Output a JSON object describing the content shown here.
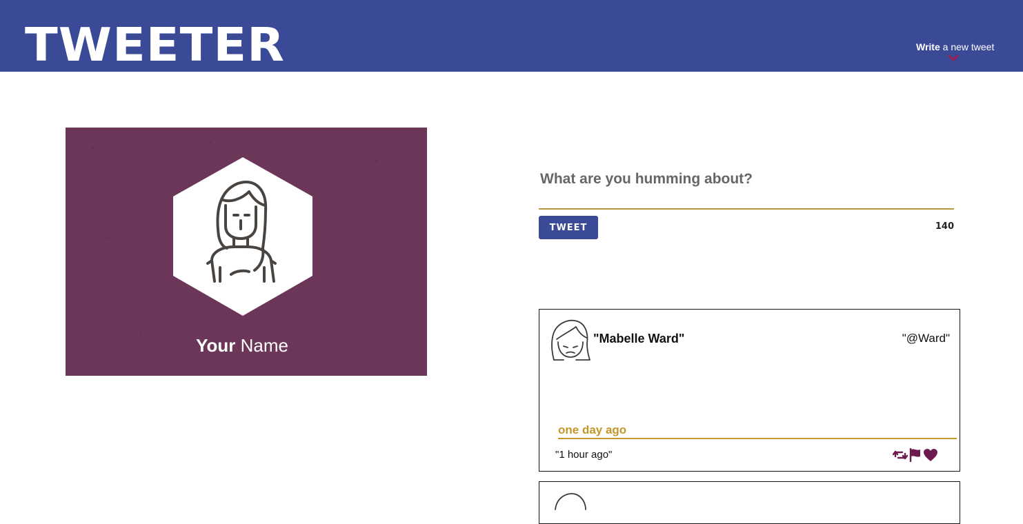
{
  "header": {
    "logo": "TWEETER",
    "write_strong": "Write",
    "write_rest": " a new tweet",
    "chevron_icon": "chevron-down-icon",
    "bg_color": "#3b4a97",
    "chevron_color": "#a01e4e"
  },
  "profile": {
    "name_strong": "Your",
    "name_rest": " Name",
    "avatar_icon": "girl-avatar-icon",
    "bg_color": "#6c3659"
  },
  "compose": {
    "placeholder": "What are you humming about?",
    "button_label": "TWEET",
    "counter": "140",
    "accent": "#b6973c"
  },
  "tweets": [
    {
      "author": "\"Mabelle Ward\"",
      "handle": "\"@Ward\"",
      "content": "one day ago",
      "time": "\"1 hour ago\"",
      "avatar_icon": "sad-girl-avatar-icon",
      "actions": [
        "retweet-icon",
        "flag-icon",
        "heart-icon"
      ],
      "action_color": "#6d1b4e",
      "content_color": "#c5972a"
    }
  ]
}
